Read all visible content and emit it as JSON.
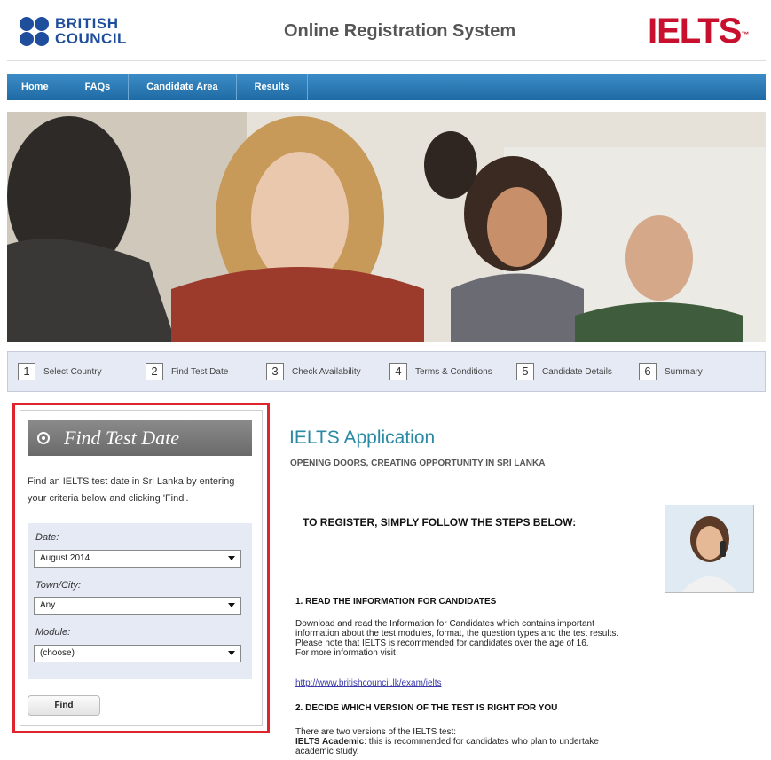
{
  "header": {
    "bc_logo_line1": "BRITISH",
    "bc_logo_line2": "COUNCIL",
    "site_title": "Online Registration System",
    "ielts_logo": "IELTS",
    "ielts_tm": "™"
  },
  "nav": {
    "items": [
      {
        "label": "Home"
      },
      {
        "label": "FAQs"
      },
      {
        "label": "Candidate Area"
      },
      {
        "label": "Results"
      }
    ]
  },
  "steps": [
    {
      "num": "1",
      "label": "Select Country"
    },
    {
      "num": "2",
      "label": "Find Test Date"
    },
    {
      "num": "3",
      "label": "Check Availability"
    },
    {
      "num": "4",
      "label": "Terms & Conditions"
    },
    {
      "num": "5",
      "label": "Candidate Details"
    },
    {
      "num": "6",
      "label": "Summary"
    }
  ],
  "sidebar": {
    "title": "Find Test Date",
    "description": "Find an IELTS test date in Sri Lanka by entering your criteria below and clicking 'Find'.",
    "date_label": "Date:",
    "date_value": "August 2014",
    "town_label": "Town/City:",
    "town_value": "Any",
    "module_label": "Module:",
    "module_value": "(choose)",
    "find_label": "Find"
  },
  "main": {
    "title": "IELTS Application",
    "subtitle": "OPENING DOORS, CREATING OPPORTUNITY IN SRI LANKA",
    "register_heading": "TO REGISTER, SIMPLY FOLLOW THE STEPS BELOW:",
    "step1_heading": "1. READ THE INFORMATION FOR CANDIDATES",
    "step1_body": "Download and read the Information for Candidates which contains important information about the test modules, format, the question types and the test results. Please note that IELTS is recommended for candidates over the age of 16.",
    "step1_more": "For more information visit",
    "step1_link": "http://www.britishcouncil.lk/exam/ielts",
    "step2_heading": "2. DECIDE WHICH VERSION OF THE TEST IS RIGHT FOR YOU",
    "step2_intro": "There are two versions of the IELTS test:",
    "step2_academic_label": "IELTS Academic",
    "step2_academic_text": ": this is recommended for candidates who plan to undertake academic study."
  },
  "colors": {
    "nav_blue": "#1f6aa5",
    "ielts_red": "#c8102e",
    "british_council_blue": "#1f4e9c",
    "title_teal": "#2a8aa6",
    "highlight_red": "#e1232b"
  }
}
